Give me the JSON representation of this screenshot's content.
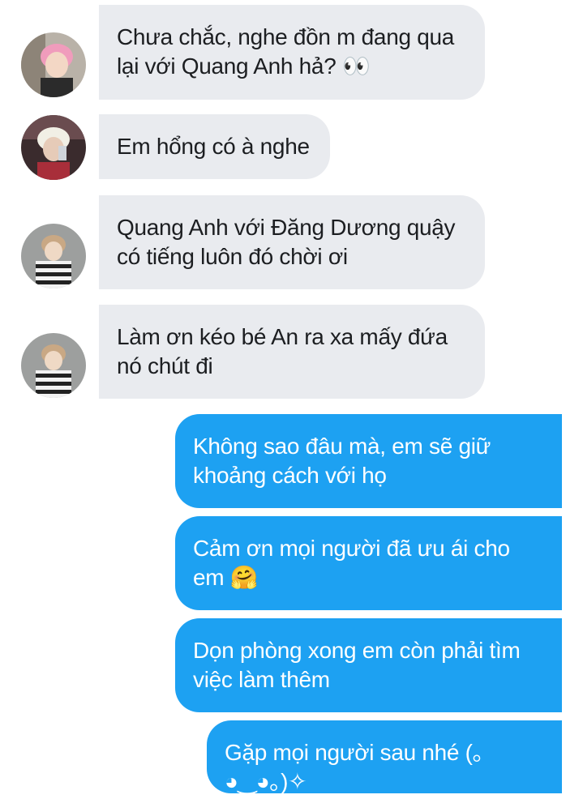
{
  "conversation": {
    "incoming": [
      {
        "text": "Chưa chắc, nghe đồn m đang qua lại với Quang Anh hả? 👀",
        "avatar": "avatar-pink-hair"
      },
      {
        "text": "Em hổng có à nghe",
        "avatar": "avatar-blonde-hair"
      },
      {
        "text": "Quang Anh với Đăng Dương quậy có tiếng luôn đó chời ơi",
        "avatar": "avatar-striped-sweater"
      },
      {
        "text": "Làm ơn kéo bé An ra xa mấy đứa nó chút đi",
        "avatar": "avatar-striped-sweater"
      }
    ],
    "outgoing": [
      {
        "text": "Không sao đâu mà, em sẽ giữ khoảng cách với họ"
      },
      {
        "text": "Cảm ơn mọi người đã ưu ái cho em 🤗"
      },
      {
        "text": "Dọn phòng xong em còn phải tìm việc làm thêm"
      },
      {
        "text": "Gặp mọi người sau nhé (｡◕‿◕｡)✧"
      }
    ]
  },
  "colors": {
    "incoming_bubble": "#e9ebef",
    "outgoing_bubble": "#1da1f2",
    "incoming_text": "#1c1e21",
    "outgoing_text": "#ffffff"
  }
}
